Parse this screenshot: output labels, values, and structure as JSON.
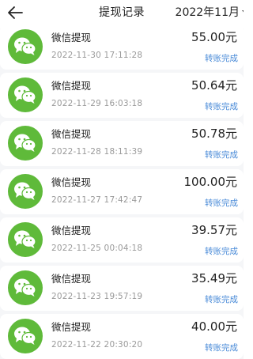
{
  "header": {
    "back_icon": "back-arrow-icon",
    "title": "提现记录",
    "month_filter": "2022年11月"
  },
  "records": [
    {
      "title": "微信提现",
      "time": "2022-11-30 17:11:28",
      "amount": "55.00元",
      "status": "转账完成",
      "icon": "wechat-icon"
    },
    {
      "title": "微信提现",
      "time": "2022-11-29 16:03:18",
      "amount": "50.64元",
      "status": "转账完成",
      "icon": "wechat-icon"
    },
    {
      "title": "微信提现",
      "time": "2022-11-28 18:11:39",
      "amount": "50.78元",
      "status": "转账完成",
      "icon": "wechat-icon"
    },
    {
      "title": "微信提现",
      "time": "2022-11-27 17:42:47",
      "amount": "100.00元",
      "status": "转账完成",
      "icon": "wechat-icon"
    },
    {
      "title": "微信提现",
      "time": "2022-11-25 00:04:18",
      "amount": "39.57元",
      "status": "转账完成",
      "icon": "wechat-icon"
    },
    {
      "title": "微信提现",
      "time": "2022-11-23 19:57:19",
      "amount": "35.49元",
      "status": "转账完成",
      "icon": "wechat-icon"
    },
    {
      "title": "微信提现",
      "time": "2022-11-22 20:30:20",
      "amount": "40.00元",
      "status": "转账完成",
      "icon": "wechat-icon"
    }
  ],
  "colors": {
    "wechat_green": "#5fba3a",
    "status_blue": "#4a8bd8",
    "page_bg": "#f5f6f8"
  }
}
